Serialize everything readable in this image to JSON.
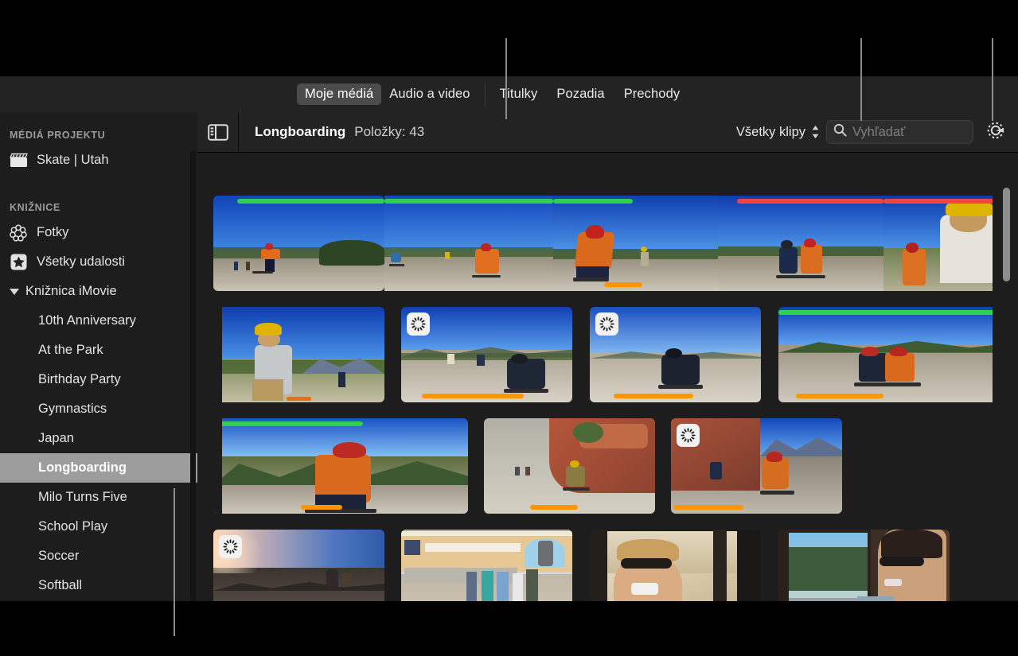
{
  "app": {
    "name": "iMovie"
  },
  "tabs": [
    {
      "label": "Moje médiá",
      "active": true,
      "name": "tab-my-media"
    },
    {
      "label": "Audio a video",
      "active": false,
      "name": "tab-audio-video"
    },
    {
      "label": "Titulky",
      "active": false,
      "name": "tab-titles"
    },
    {
      "label": "Pozadia",
      "active": false,
      "name": "tab-backgrounds"
    },
    {
      "label": "Prechody",
      "active": false,
      "name": "tab-transitions"
    }
  ],
  "sidebar": {
    "section_project": "MÉDIÁ PROJEKTU",
    "project_item": {
      "label": "Skate | Utah",
      "icon": "clapperboard-icon"
    },
    "section_library": "KNIŽNICE",
    "library_items": [
      {
        "label": "Fotky",
        "icon": "photos-flower-icon",
        "level": "top",
        "selected": false
      },
      {
        "label": "Všetky udalosti",
        "icon": "star-icon",
        "level": "top",
        "selected": false
      },
      {
        "label": "Knižnica iMovie",
        "icon": "disclosure-triangle-icon",
        "level": "group",
        "selected": false
      },
      {
        "label": "10th Anniversary",
        "icon": "",
        "level": "child",
        "selected": false
      },
      {
        "label": "At the Park",
        "icon": "",
        "level": "child",
        "selected": false
      },
      {
        "label": "Birthday Party",
        "icon": "",
        "level": "child",
        "selected": false
      },
      {
        "label": "Gymnastics",
        "icon": "",
        "level": "child",
        "selected": false
      },
      {
        "label": "Japan",
        "icon": "",
        "level": "child",
        "selected": false
      },
      {
        "label": "Longboarding",
        "icon": "",
        "level": "child",
        "selected": true
      },
      {
        "label": "Milo Turns Five",
        "icon": "",
        "level": "child",
        "selected": false
      },
      {
        "label": "School Play",
        "icon": "",
        "level": "child",
        "selected": false
      },
      {
        "label": "Soccer",
        "icon": "",
        "level": "child",
        "selected": false
      },
      {
        "label": "Softball",
        "icon": "",
        "level": "child",
        "selected": false
      }
    ]
  },
  "browser_toolbar": {
    "sidebar_toggle_icon": "sidebar-toggle-icon",
    "title": "Longboarding",
    "item_count_label": "Položky: 43",
    "filter_value": "Všetky klipy",
    "stepper_icon": "up-down-chevrons-icon",
    "search_icon": "search-icon",
    "search_placeholder": "Vyhľadať",
    "search_value": "",
    "settings_icon": "gear-icon"
  },
  "colors": {
    "favorite_bar": "#2fd14f",
    "rejected_bar": "#f2453d",
    "keyword_bar": "#ff9500",
    "selection": "#9d9d9d",
    "panel_bg": "#1d1d1d",
    "toolbar_bg": "#232323",
    "callout_line": "#8c8c8c"
  },
  "media_grid": {
    "rows": [
      {
        "row": 1,
        "clips": [
          {
            "name": "clip-skater-orange-shirt-a",
            "top_bar": "favorite",
            "bottom_bar": "none",
            "badge": "none",
            "torn_left": false,
            "torn_right": false
          },
          {
            "name": "clip-skater-distance-b",
            "top_bar": "favorite",
            "bottom_bar": "none",
            "badge": "none",
            "torn_left": false,
            "torn_right": false
          },
          {
            "name": "clip-skater-crouch-c",
            "top_bar": "favorite",
            "bottom_bar": "keyword",
            "badge": "none",
            "torn_left": false,
            "torn_right": false
          },
          {
            "name": "clip-two-skaters-d",
            "top_bar": "rejected",
            "bottom_bar": "none",
            "badge": "none",
            "torn_left": false,
            "torn_right": false
          },
          {
            "name": "clip-yellow-helmet-e",
            "top_bar": "rejected",
            "bottom_bar": "none",
            "badge": "none",
            "torn_left": false,
            "torn_right": true
          }
        ]
      },
      {
        "row": 2,
        "clips": [
          {
            "name": "clip-yellow-helmet-cont",
            "top_bar": "none",
            "bottom_bar": "none",
            "badge": "none",
            "torn_left": true,
            "torn_right": false
          },
          {
            "name": "clip-downhill-pack",
            "top_bar": "none",
            "bottom_bar": "keyword",
            "badge": "slow-motion",
            "torn_left": false,
            "torn_right": false
          },
          {
            "name": "clip-lone-skater-carve",
            "top_bar": "none",
            "bottom_bar": "keyword",
            "badge": "slow-motion",
            "torn_left": false,
            "torn_right": false
          },
          {
            "name": "clip-pair-downhill",
            "top_bar": "favorite",
            "bottom_bar": "keyword",
            "badge": "none",
            "torn_left": false,
            "torn_right": true
          }
        ]
      },
      {
        "row": 3,
        "clips": [
          {
            "name": "clip-pair-downhill-cont",
            "top_bar": "favorite",
            "bottom_bar": "keyword",
            "badge": "none",
            "torn_left": true,
            "torn_right": false
          },
          {
            "name": "clip-red-rocks-road",
            "top_bar": "none",
            "bottom_bar": "keyword",
            "badge": "none",
            "torn_left": false,
            "torn_right": false
          },
          {
            "name": "clip-canyon-descent",
            "top_bar": "none",
            "bottom_bar": "keyword",
            "badge": "slow-motion",
            "torn_left": false,
            "torn_right": false
          }
        ]
      },
      {
        "row": 4,
        "clips": [
          {
            "name": "clip-sunset-road",
            "top_bar": "none",
            "bottom_bar": "keyword",
            "badge": "slow-motion",
            "torn_left": false,
            "torn_right": false
          },
          {
            "name": "clip-crossroads-trading-post",
            "top_bar": "none",
            "bottom_bar": "keyword",
            "badge": "none",
            "torn_left": false,
            "torn_right": false,
            "selected": true
          },
          {
            "name": "clip-van-laughing-guy",
            "top_bar": "none",
            "bottom_bar": "keyword",
            "badge": "none",
            "torn_left": false,
            "torn_right": false
          },
          {
            "name": "clip-van-woman-talking",
            "top_bar": "none",
            "bottom_bar": "keyword",
            "badge": "none",
            "torn_left": false,
            "torn_right": false
          }
        ]
      }
    ]
  },
  "scrollbars": {
    "media_vertical": "media-scrollbar",
    "sidebar_vertical": "sidebar-scrollbar"
  },
  "callouts": [
    {
      "name": "callout-line-tabs"
    },
    {
      "name": "callout-line-search"
    },
    {
      "name": "callout-line-settings"
    },
    {
      "name": "callout-line-sidebar-selection"
    }
  ]
}
